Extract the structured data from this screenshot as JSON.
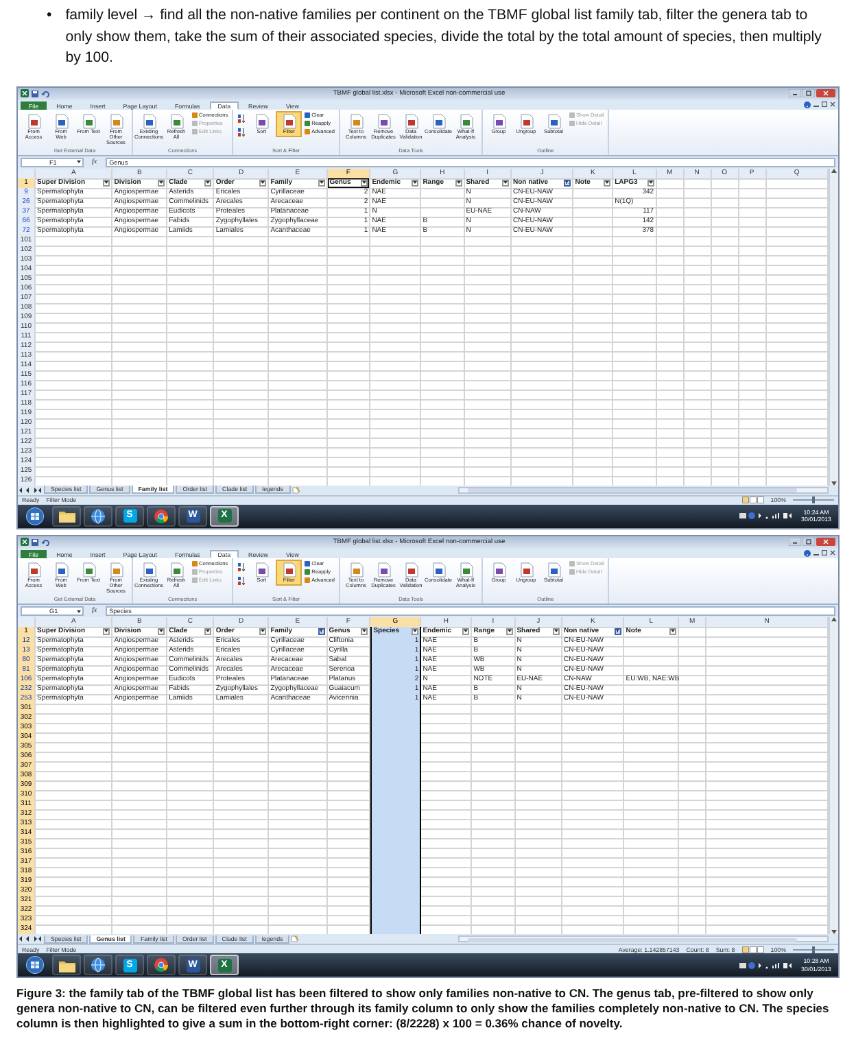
{
  "intro": {
    "bullet": "•",
    "text": "family level → find all the non-native families per continent on the TBMF global list family tab, filter the genera tab to only show them, take the sum of their associated species, divide the total by the total amount of species, then multiply by 100."
  },
  "screenshots": [
    {
      "title": "TBMF global list.xlsx - Microsoft Excel non-commercial use",
      "ribbon_tabs": [
        {
          "label": "File",
          "kind": "file",
          "selected": false
        },
        {
          "label": "Home",
          "kind": "tab",
          "selected": false
        },
        {
          "label": "Insert",
          "kind": "tab",
          "selected": false
        },
        {
          "label": "Page Layout",
          "kind": "tab",
          "selected": false
        },
        {
          "label": "Formulas",
          "kind": "tab",
          "selected": false
        },
        {
          "label": "Data",
          "kind": "tab",
          "selected": true
        },
        {
          "label": "Review",
          "kind": "tab",
          "selected": false
        },
        {
          "label": "View",
          "kind": "tab",
          "selected": false
        }
      ],
      "ribbon_groups": [
        {
          "label": "Get External Data",
          "buttons": [
            {
              "kind": "large",
              "label": "From Access",
              "disabled": false,
              "on": false
            },
            {
              "kind": "large",
              "label": "From Web",
              "disabled": false,
              "on": false
            },
            {
              "kind": "large",
              "label": "From Text",
              "disabled": false,
              "on": false
            },
            {
              "kind": "large",
              "label": "From Other Sources",
              "disabled": false,
              "on": false
            }
          ]
        },
        {
          "label": "Connections",
          "buttons": [
            {
              "kind": "large",
              "label": "Existing Connections",
              "disabled": false,
              "on": false
            },
            {
              "kind": "large",
              "label": "Refresh All",
              "disabled": false,
              "on": false
            },
            {
              "kind": "small",
              "label": "Connections",
              "disabled": false,
              "on": false
            },
            {
              "kind": "small",
              "label": "Properties",
              "disabled": true,
              "on": false
            },
            {
              "kind": "small",
              "label": "Edit Links",
              "disabled": true,
              "on": false
            }
          ]
        },
        {
          "label": "Sort & Filter",
          "buttons": [
            {
              "kind": "icon",
              "disabled": false,
              "on": false
            },
            {
              "kind": "icon",
              "disabled": false,
              "on": false
            },
            {
              "kind": "large",
              "label": "Sort",
              "disabled": false,
              "on": false
            },
            {
              "kind": "large",
              "label": "Filter",
              "disabled": false,
              "on": true
            },
            {
              "kind": "small",
              "label": "Clear",
              "disabled": false,
              "on": false
            },
            {
              "kind": "small",
              "label": "Reapply",
              "disabled": false,
              "on": false
            },
            {
              "kind": "small",
              "label": "Advanced",
              "disabled": false,
              "on": false
            }
          ]
        },
        {
          "label": "Data Tools",
          "buttons": [
            {
              "kind": "large",
              "label": "Text to Columns",
              "disabled": false,
              "on": false
            },
            {
              "kind": "large",
              "label": "Remove Duplicates",
              "disabled": false,
              "on": false
            },
            {
              "kind": "large",
              "label": "Data Validation",
              "disabled": false,
              "on": false
            },
            {
              "kind": "large",
              "label": "Consolidate",
              "disabled": false,
              "on": false
            },
            {
              "kind": "large",
              "label": "What-If Analysis",
              "disabled": false,
              "on": false
            }
          ]
        },
        {
          "label": "Outline",
          "buttons": [
            {
              "kind": "large",
              "label": "Group",
              "disabled": false,
              "on": false
            },
            {
              "kind": "large",
              "label": "Ungroup",
              "disabled": false,
              "on": false
            },
            {
              "kind": "large",
              "label": "Subtotal",
              "disabled": false,
              "on": false
            },
            {
              "kind": "small",
              "label": "Show Detail",
              "disabled": true,
              "on": false
            },
            {
              "kind": "small",
              "label": "Hide Detail",
              "disabled": true,
              "on": false
            }
          ]
        }
      ],
      "name_box": "F1",
      "fx": "fx",
      "formula": "Genus",
      "whole_column_selected": false,
      "columns": [
        {
          "letter": "A",
          "header": "Super Division",
          "filtered": false,
          "selected": false
        },
        {
          "letter": "B",
          "header": "Division",
          "filtered": false,
          "selected": false
        },
        {
          "letter": "C",
          "header": "Clade",
          "filtered": false,
          "selected": false
        },
        {
          "letter": "D",
          "header": "Order",
          "filtered": false,
          "selected": false
        },
        {
          "letter": "E",
          "header": "Family",
          "filtered": false,
          "selected": false
        },
        {
          "letter": "F",
          "header": "Genus",
          "filtered": false,
          "selected": true
        },
        {
          "letter": "G",
          "header": "Endemic",
          "filtered": false,
          "selected": false
        },
        {
          "letter": "H",
          "header": "Range",
          "filtered": false,
          "selected": false
        },
        {
          "letter": "I",
          "header": "Shared",
          "filtered": false,
          "selected": false
        },
        {
          "letter": "J",
          "header": "Non native",
          "filtered": true,
          "selected": false
        },
        {
          "letter": "K",
          "header": "Note",
          "filtered": false,
          "selected": false
        },
        {
          "letter": "L",
          "header": "LAPG3",
          "filtered": false,
          "selected": false
        },
        {
          "letter": "M",
          "selected": false
        },
        {
          "letter": "N",
          "selected": false
        },
        {
          "letter": "O",
          "selected": false
        },
        {
          "letter": "P",
          "selected": false
        },
        {
          "letter": "Q",
          "selected": false
        }
      ],
      "header_row": "1",
      "rows": [
        {
          "number": "9",
          "cells": [
            "Spermatophyta",
            "Angiospermae",
            "Asterids",
            "Ericales",
            "Cyrillaceae",
            "2",
            "NAE",
            null,
            "N",
            "CN-EU-NAW",
            null,
            "342"
          ]
        },
        {
          "number": "26",
          "cells": [
            "Spermatophyta",
            "Angiospermae",
            "Commelinids",
            "Arecales",
            "Arecaceae",
            "2",
            "NAE",
            null,
            "N",
            "CN-EU-NAW",
            null,
            "N(1Q)"
          ]
        },
        {
          "number": "37",
          "cells": [
            "Spermatophyta",
            "Angiospermae",
            "Eudicots",
            "Proteales",
            "Platanaceae",
            "1",
            "N",
            null,
            "EU-NAE",
            "CN-NAW",
            null,
            "117"
          ]
        },
        {
          "number": "66",
          "cells": [
            "Spermatophyta",
            "Angiospermae",
            "Fabids",
            "Zygophyllales",
            "Zygophyllaceae",
            "1",
            "NAE",
            "B",
            "N",
            "CN-EU-NAW",
            null,
            "142"
          ]
        },
        {
          "number": "72",
          "cells": [
            "Spermatophyta",
            "Angiospermae",
            "Lamiids",
            "Lamiales",
            "Acanthaceae",
            "1",
            "NAE",
            "B",
            "N",
            "CN-EU-NAW",
            null,
            "378"
          ]
        }
      ],
      "empty_rows": [
        "101",
        "102",
        "103",
        "104",
        "105",
        "106",
        "107",
        "108",
        "109",
        "110",
        "111",
        "112",
        "113",
        "114",
        "115",
        "116",
        "117",
        "118",
        "119",
        "120",
        "121",
        "122",
        "123",
        "124",
        "125",
        "126"
      ],
      "sheet_tabs": [
        {
          "label": "Species list",
          "selected": false
        },
        {
          "label": "Genus list",
          "selected": false
        },
        {
          "label": "Family list",
          "selected": true
        },
        {
          "label": "Order list",
          "selected": false
        },
        {
          "label": "Clade list",
          "selected": false
        },
        {
          "label": "legends",
          "selected": false
        }
      ],
      "status": {
        "mode": "Ready",
        "filter": "Filter Mode",
        "zoom": "100%",
        "level": 0.5
      },
      "taskbar": {
        "apps": [
          {
            "kind": "start",
            "selected": false
          },
          {
            "kind": "folder",
            "selected": false
          },
          {
            "kind": "globe",
            "selected": false
          },
          {
            "kind": "letter",
            "glyph": "S",
            "color": "#00a8e8",
            "selected": false
          },
          {
            "kind": "round",
            "selected": false
          },
          {
            "kind": "letter",
            "glyph": "W",
            "color": "#2b579a",
            "selected": false
          },
          {
            "kind": "letter",
            "glyph": "X",
            "color": "#1e7145",
            "selected": true
          }
        ],
        "time": "10:24 AM",
        "date": "30/01/2013"
      }
    },
    {
      "title": "TBMF global list.xlsx - Microsoft Excel non-commercial use",
      "ribbon_tabs": [
        {
          "label": "File",
          "kind": "file",
          "selected": false
        },
        {
          "label": "Home",
          "kind": "tab",
          "selected": false
        },
        {
          "label": "Insert",
          "kind": "tab",
          "selected": false
        },
        {
          "label": "Page Layout",
          "kind": "tab",
          "selected": false
        },
        {
          "label": "Formulas",
          "kind": "tab",
          "selected": false
        },
        {
          "label": "Data",
          "kind": "tab",
          "selected": true
        },
        {
          "label": "Review",
          "kind": "tab",
          "selected": false
        },
        {
          "label": "View",
          "kind": "tab",
          "selected": false
        }
      ],
      "ribbon_groups": [
        {
          "label": "Get External Data",
          "buttons": [
            {
              "kind": "large",
              "label": "From Access",
              "disabled": false,
              "on": false
            },
            {
              "kind": "large",
              "label": "From Web",
              "disabled": false,
              "on": false
            },
            {
              "kind": "large",
              "label": "From Text",
              "disabled": false,
              "on": false
            },
            {
              "kind": "large",
              "label": "From Other Sources",
              "disabled": false,
              "on": false
            }
          ]
        },
        {
          "label": "Connections",
          "buttons": [
            {
              "kind": "large",
              "label": "Existing Connections",
              "disabled": false,
              "on": false
            },
            {
              "kind": "large",
              "label": "Refresh All",
              "disabled": false,
              "on": false
            },
            {
              "kind": "small",
              "label": "Connections",
              "disabled": false,
              "on": false
            },
            {
              "kind": "small",
              "label": "Properties",
              "disabled": true,
              "on": false
            },
            {
              "kind": "small",
              "label": "Edit Links",
              "disabled": true,
              "on": false
            }
          ]
        },
        {
          "label": "Sort & Filter",
          "buttons": [
            {
              "kind": "icon",
              "disabled": false,
              "on": false
            },
            {
              "kind": "icon",
              "disabled": false,
              "on": false
            },
            {
              "kind": "large",
              "label": "Sort",
              "disabled": false,
              "on": false
            },
            {
              "kind": "large",
              "label": "Filter",
              "disabled": false,
              "on": true
            },
            {
              "kind": "small",
              "label": "Clear",
              "disabled": false,
              "on": false
            },
            {
              "kind": "small",
              "label": "Reapply",
              "disabled": false,
              "on": false
            },
            {
              "kind": "small",
              "label": "Advanced",
              "disabled": false,
              "on": false
            }
          ]
        },
        {
          "label": "Data Tools",
          "buttons": [
            {
              "kind": "large",
              "label": "Text to Columns",
              "disabled": false,
              "on": false
            },
            {
              "kind": "large",
              "label": "Remove Duplicates",
              "disabled": false,
              "on": false
            },
            {
              "kind": "large",
              "label": "Data Validation",
              "disabled": false,
              "on": false
            },
            {
              "kind": "large",
              "label": "Consolidate",
              "disabled": false,
              "on": false
            },
            {
              "kind": "large",
              "label": "What-If Analysis",
              "disabled": false,
              "on": false
            }
          ]
        },
        {
          "label": "Outline",
          "buttons": [
            {
              "kind": "large",
              "label": "Group",
              "disabled": false,
              "on": false
            },
            {
              "kind": "large",
              "label": "Ungroup",
              "disabled": false,
              "on": false
            },
            {
              "kind": "large",
              "label": "Subtotal",
              "disabled": false,
              "on": false
            },
            {
              "kind": "small",
              "label": "Show Detail",
              "disabled": true,
              "on": false
            },
            {
              "kind": "small",
              "label": "Hide Detail",
              "disabled": true,
              "on": false
            }
          ]
        }
      ],
      "name_box": "G1",
      "fx": "fx",
      "formula": "Species",
      "whole_column_selected": true,
      "columns": [
        {
          "letter": "A",
          "header": "Super Division",
          "filtered": false,
          "selected": false
        },
        {
          "letter": "B",
          "header": "Division",
          "filtered": false,
          "selected": false
        },
        {
          "letter": "C",
          "header": "Clade",
          "filtered": false,
          "selected": false
        },
        {
          "letter": "D",
          "header": "Order",
          "filtered": false,
          "selected": false
        },
        {
          "letter": "E",
          "header": "Family",
          "filtered": true,
          "selected": false
        },
        {
          "letter": "F",
          "header": "Genus",
          "filtered": false,
          "selected": false
        },
        {
          "letter": "G",
          "header": "Species",
          "filtered": false,
          "selected": true
        },
        {
          "letter": "H",
          "header": "Endemic",
          "filtered": false,
          "selected": false
        },
        {
          "letter": "I",
          "header": "Range",
          "filtered": false,
          "selected": false
        },
        {
          "letter": "J",
          "header": "Shared",
          "filtered": false,
          "selected": false
        },
        {
          "letter": "K",
          "header": "Non native",
          "filtered": true,
          "selected": false
        },
        {
          "letter": "L",
          "header": "Note",
          "filtered": false,
          "selected": false
        },
        {
          "letter": "M",
          "selected": false
        },
        {
          "letter": "N",
          "selected": false
        }
      ],
      "header_row": "1",
      "rows": [
        {
          "number": "12",
          "cells": [
            "Spermatophyta",
            "Angiospermae",
            "Asterids",
            "Ericales",
            "Cyrillaceae",
            "Cliftonia",
            "1",
            "NAE",
            "B",
            "N",
            "CN-EU-NAW",
            null
          ]
        },
        {
          "number": "13",
          "cells": [
            "Spermatophyta",
            "Angiospermae",
            "Asterids",
            "Ericales",
            "Cyrillaceae",
            "Cyrilla",
            "1",
            "NAE",
            "B",
            "N",
            "CN-EU-NAW",
            null
          ]
        },
        {
          "number": "80",
          "cells": [
            "Spermatophyta",
            "Angiospermae",
            "Commelinids",
            "Arecales",
            "Arecaceae",
            "Sabal",
            "1",
            "NAE",
            "WB",
            "N",
            "CN-EU-NAW",
            null
          ]
        },
        {
          "number": "81",
          "cells": [
            "Spermatophyta",
            "Angiospermae",
            "Commelinids",
            "Arecales",
            "Arecaceae",
            "Serenoa",
            "1",
            "NAE",
            "WB",
            "N",
            "CN-EU-NAW",
            null
          ]
        },
        {
          "number": "106",
          "cells": [
            "Spermatophyta",
            "Angiospermae",
            "Eudicots",
            "Proteales",
            "Platanaceae",
            "Platanus",
            "2",
            "N",
            "NOTE",
            "EU-NAE",
            "CN-NAW",
            "EU:WB, NAE:WB"
          ]
        },
        {
          "number": "232",
          "cells": [
            "Spermatophyta",
            "Angiospermae",
            "Fabids",
            "Zygophyllales",
            "Zygophyllaceae",
            "Guaiacum",
            "1",
            "NAE",
            "B",
            "N",
            "CN-EU-NAW",
            null
          ]
        },
        {
          "number": "253",
          "cells": [
            "Spermatophyta",
            "Angiospermae",
            "Lamiids",
            "Lamiales",
            "Acanthaceae",
            "Avicennia",
            "1",
            "NAE",
            "B",
            "N",
            "CN-EU-NAW",
            null
          ]
        }
      ],
      "empty_rows": [
        "301",
        "302",
        "303",
        "304",
        "305",
        "306",
        "307",
        "308",
        "309",
        "310",
        "311",
        "312",
        "313",
        "314",
        "315",
        "316",
        "317",
        "318",
        "319",
        "320",
        "321",
        "322",
        "323",
        "324"
      ],
      "sheet_tabs": [
        {
          "label": "Species list",
          "selected": false
        },
        {
          "label": "Genus list",
          "selected": true
        },
        {
          "label": "Family list",
          "selected": false
        },
        {
          "label": "Order list",
          "selected": false
        },
        {
          "label": "Clade list",
          "selected": false
        },
        {
          "label": "legends",
          "selected": false
        }
      ],
      "status": {
        "mode": "Ready",
        "filter": "Filter Mode",
        "stats": [
          "Average: 1.142857143",
          "Count: 8",
          "Sum: 8"
        ],
        "zoom": "100%",
        "level": 0.5
      },
      "taskbar": {
        "apps": [
          {
            "kind": "start",
            "selected": false
          },
          {
            "kind": "folder",
            "selected": false
          },
          {
            "kind": "globe",
            "selected": false
          },
          {
            "kind": "letter",
            "glyph": "S",
            "color": "#00a8e8",
            "selected": false
          },
          {
            "kind": "round",
            "selected": false
          },
          {
            "kind": "letter",
            "glyph": "W",
            "color": "#2b579a",
            "selected": false
          },
          {
            "kind": "letter",
            "glyph": "X",
            "color": "#1e7145",
            "selected": true
          }
        ],
        "time": "10:28 AM",
        "date": "30/01/2013"
      }
    }
  ],
  "caption": "Figure 3: the family tab of the TBMF global list has been filtered to show only families non-native to CN. The genus tab, pre-filtered to show only genera non-native to CN, can be filtered even further through its family column to only show the families completely non-native to CN. The species column is then highlighted to give a sum in the bottom-right corner: (8/2228) x 100 = 0.36% chance of novelty."
}
